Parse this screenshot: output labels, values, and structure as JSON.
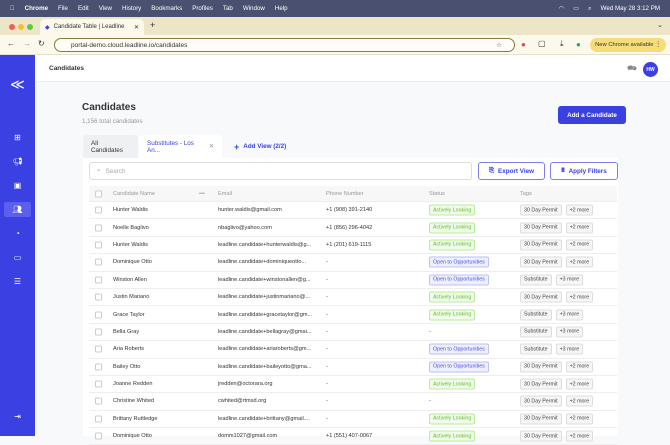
{
  "menubar": {
    "app": "Chrome",
    "items": [
      "File",
      "Edit",
      "View",
      "History",
      "Bookmarks",
      "Profiles",
      "Tab",
      "Window",
      "Help"
    ],
    "datetime": "Wed May 28  3:12 PM"
  },
  "browser": {
    "tab_title": "Candidate Table | Leadline",
    "url": "portal-demo.cloud.leadline.io/candidates",
    "update_label": "New Chrome available"
  },
  "header": {
    "breadcrumb": "Candidates",
    "avatar": "HW"
  },
  "page": {
    "title": "Candidates",
    "subtitle": "1,156 total candidates",
    "add_button": "Add a Candidate"
  },
  "views": {
    "tabs": [
      "All Candidates",
      "Substitutes - Los An..."
    ],
    "active": 1,
    "add_view": "Add View (2/2)"
  },
  "toolbar": {
    "search_placeholder": "Search",
    "export": "Export View",
    "filters": "Apply Filters"
  },
  "colors": {
    "brand": "#3b40e3",
    "active_status": "#5cbe2e",
    "open_status": "#4a50e0"
  },
  "table": {
    "columns": [
      "Candidate Name",
      "Email",
      "Phone Number",
      "Status",
      "Tags"
    ],
    "rows": [
      {
        "name": "Hunter Waldis",
        "email": "hunter.waldis@gmail.com",
        "phone": "+1 (908) 391-2140",
        "status": "Actively Looking",
        "tag": "30 Day Permit",
        "more": "+2 more"
      },
      {
        "name": "Noelle Baglivo",
        "email": "nbaglivo@yahoo.com",
        "phone": "+1 (856) 296-4042",
        "status": "Actively Looking",
        "tag": "30 Day Permit",
        "more": "+2 more"
      },
      {
        "name": "Hunter Waldis",
        "email": "leadline.candidate+hunterwaldis@g...",
        "phone": "+1 (201) 619-1115",
        "status": "Actively Looking",
        "tag": "30 Day Permit",
        "more": "+2 more"
      },
      {
        "name": "Dominique Otto",
        "email": "leadline.candidate+dominiqueotto...",
        "phone": "-",
        "status": "Open to Opportunities",
        "tag": "30 Day Permit",
        "more": "+2 more"
      },
      {
        "name": "Winston Allen",
        "email": "leadline.candidate+winstonallen@g...",
        "phone": "-",
        "status": "Open to Opportunities",
        "tag": "Substitute",
        "more": "+3 more"
      },
      {
        "name": "Justin Mariano",
        "email": "leadline.candidate+justinmariano@...",
        "phone": "-",
        "status": "Actively Looking",
        "tag": "30 Day Permit",
        "more": "+2 more"
      },
      {
        "name": "Grace Taylor",
        "email": "leadline.candidate+gracetaylor@gm...",
        "phone": "-",
        "status": "Actively Looking",
        "tag": "Substitute",
        "more": "+3 more"
      },
      {
        "name": "Bella Gray",
        "email": "leadline.candidate+bellagray@gmai...",
        "phone": "-",
        "status": "-",
        "tag": "Substitute",
        "more": "+3 more"
      },
      {
        "name": "Aria Roberts",
        "email": "leadline.candidate+ariaroberts@gm...",
        "phone": "-",
        "status": "Open to Opportunities",
        "tag": "Substitute",
        "more": "+3 more"
      },
      {
        "name": "Bailey Otto",
        "email": "leadline.candidate+baileyotto@gma...",
        "phone": "-",
        "status": "Open to Opportunities",
        "tag": "30 Day Permit",
        "more": "+2 more"
      },
      {
        "name": "Joanne Redden",
        "email": "jredden@octorara.org",
        "phone": "-",
        "status": "Actively Looking",
        "tag": "30 Day Permit",
        "more": "+2 more"
      },
      {
        "name": "Christine Whited",
        "email": "cwhited@rtmsd.org",
        "phone": "-",
        "status": "-",
        "tag": "30 Day Permit",
        "more": "+2 more"
      },
      {
        "name": "Brittany Ruttledge",
        "email": "leadline.candidate+brittany@gmail....",
        "phone": "-",
        "status": "Actively Looking",
        "tag": "30 Day Permit",
        "more": "+2 more"
      },
      {
        "name": "Dominique Otto",
        "email": "domm1027@gmail.com",
        "phone": "+1 (551) 407-0067",
        "status": "Actively Looking",
        "tag": "30 Day Permit",
        "more": "+2 more"
      }
    ]
  }
}
